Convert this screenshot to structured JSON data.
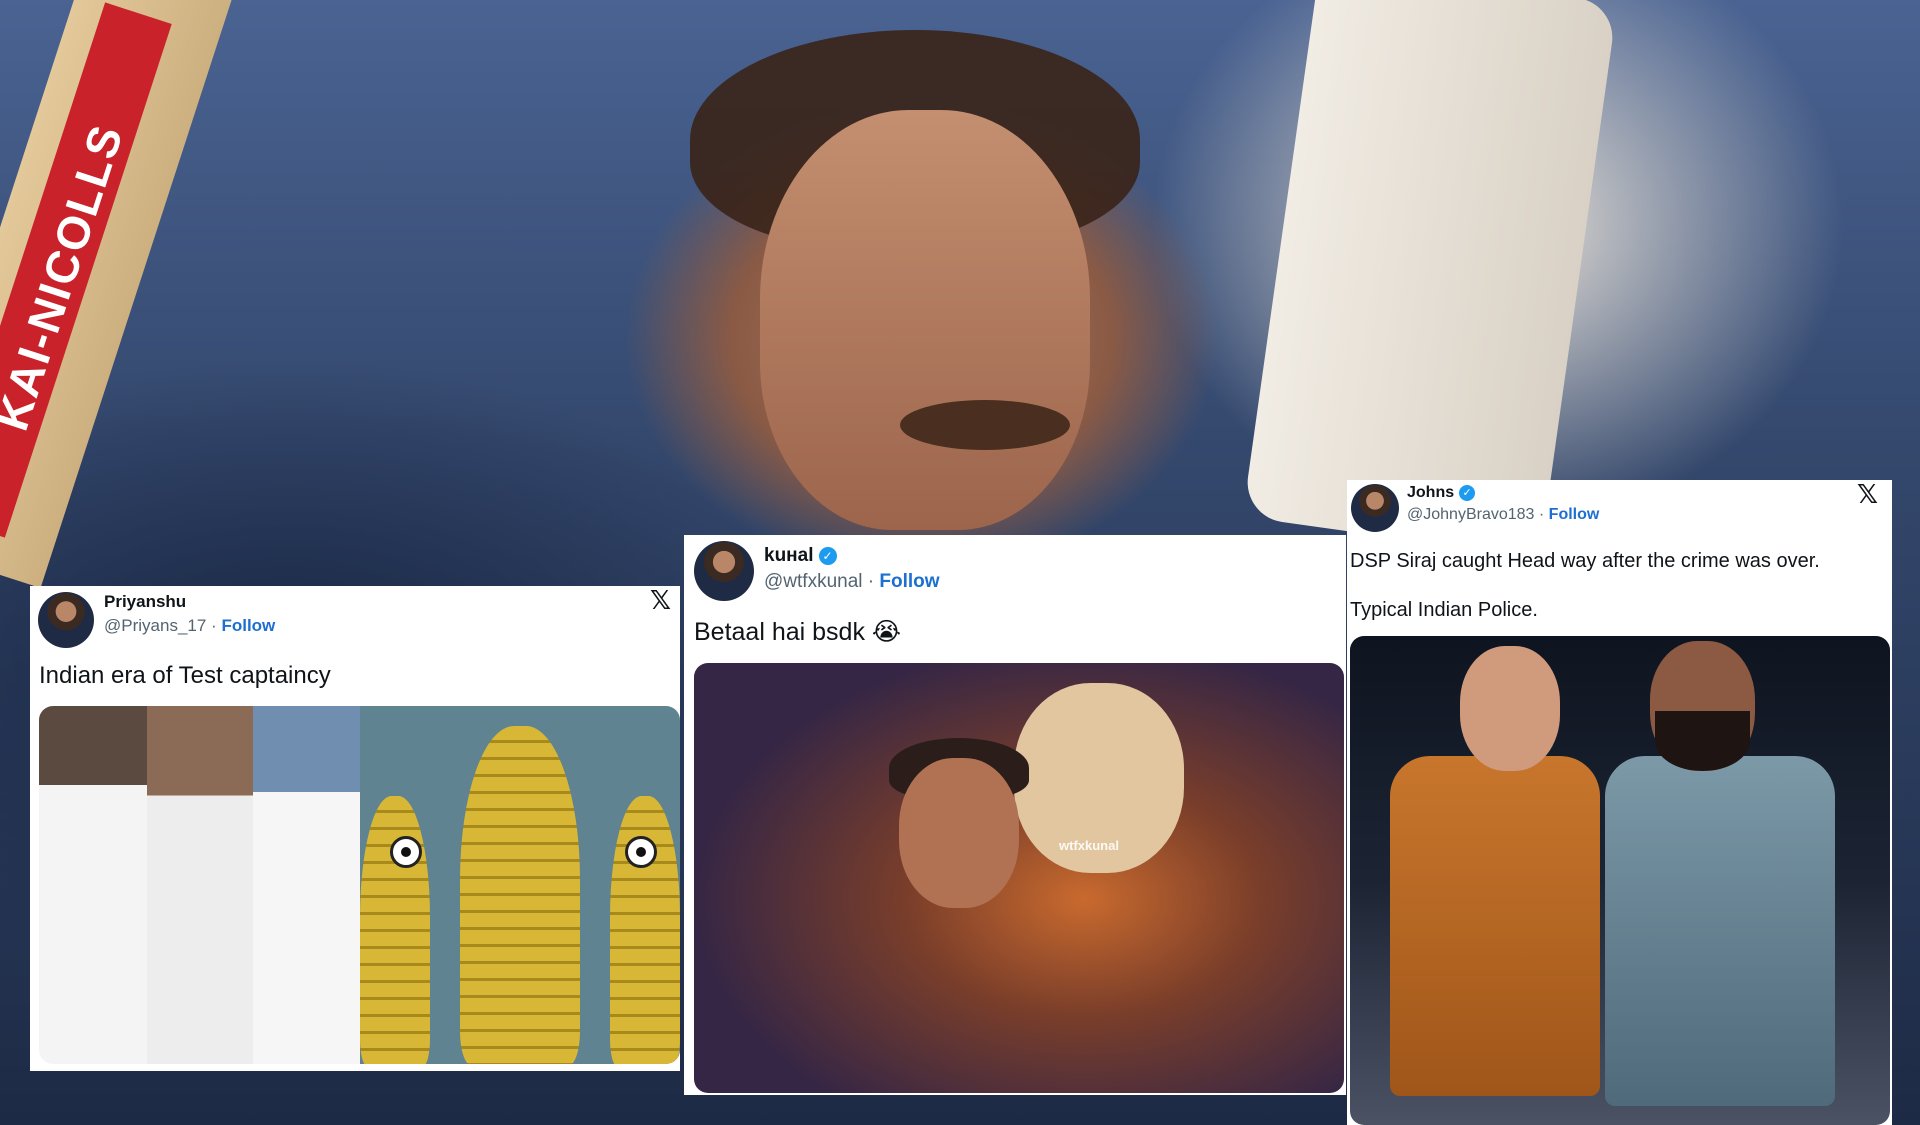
{
  "background": {
    "bat_text": "KAI-NICOLLS"
  },
  "tweets": [
    {
      "name": "Priyanshu",
      "handle": "@Priyans_17",
      "separator": "·",
      "follow": "Follow",
      "verified": false,
      "text": "Indian era of Test captaincy",
      "show_x_logo": true
    },
    {
      "name": "kuʜal",
      "handle": "@wtfxkunal",
      "separator": "·",
      "follow": "Follow",
      "verified": true,
      "text": "Betaal hai bsdk 😭",
      "watermark": "wtfxkunal",
      "show_x_logo": false
    },
    {
      "name": "Johns",
      "handle": "@JohnyBravo183",
      "separator": "·",
      "follow": "Follow",
      "verified": true,
      "text_lines": [
        "DSP Siraj caught Head way after the crime was over.",
        "Typical Indian Police."
      ],
      "show_x_logo": true
    }
  ],
  "icons": {
    "x_logo": "𝕏",
    "verified": "✓"
  }
}
